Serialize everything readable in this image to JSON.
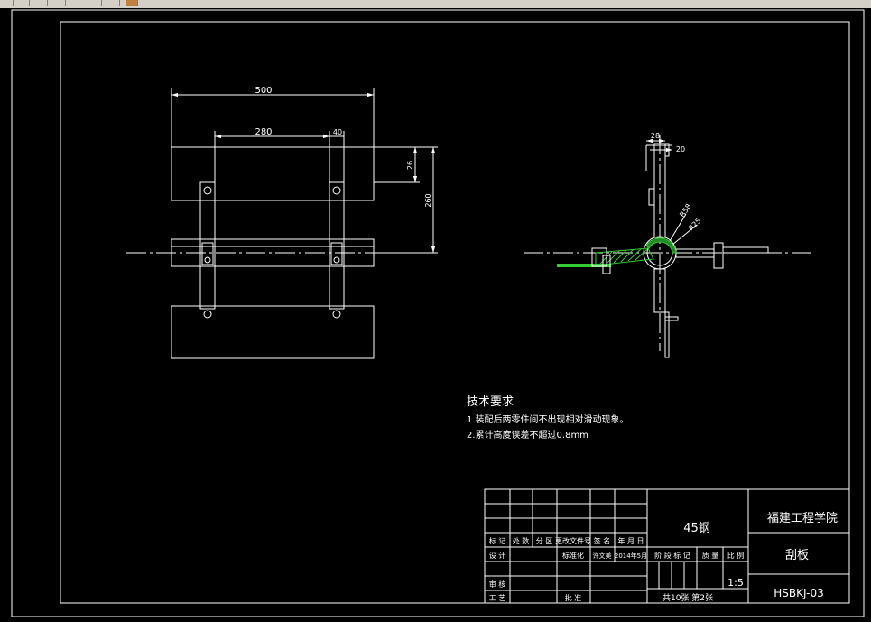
{
  "colors": {
    "background": "#000000",
    "line": "#ffffff",
    "hatch": "#33cc33",
    "toolbar": "#d4d0c8"
  },
  "front_view": {
    "dim_overall": "500",
    "dim_inner": "280",
    "dim_rod": "40",
    "dim_height_small": "26",
    "dim_height_large": "260"
  },
  "side_view": {
    "dim_top_a": "28",
    "dim_top_b": "20",
    "dim_radius_a": "R58",
    "dim_radius_b": "R25"
  },
  "notes": {
    "heading": "技术要求",
    "items": [
      "1.装配后两零件间不出现相对滑动现象。",
      "2.累计高度误差不超过0.8mm"
    ]
  },
  "title_block": {
    "material": "45钢",
    "school": "福建工程学院",
    "part_name": "刮板",
    "drawing_no": "HSBKJ-03",
    "scale": "1:5",
    "sheets": "共10张  第2张",
    "header_row": [
      "标 记",
      "处 数",
      "分 区",
      "更改文件号",
      "签 名",
      "年 月 日"
    ],
    "design_label": "设 计",
    "standard_label": "标准化",
    "standard_value": "许文美",
    "date_value": "2014年5月",
    "stage_label": "阶 段 标 记",
    "weight_label": "质 量",
    "scale_label": "比 例",
    "review_label": "审 核",
    "process_label": "工 艺",
    "approve_label": "批 准"
  }
}
